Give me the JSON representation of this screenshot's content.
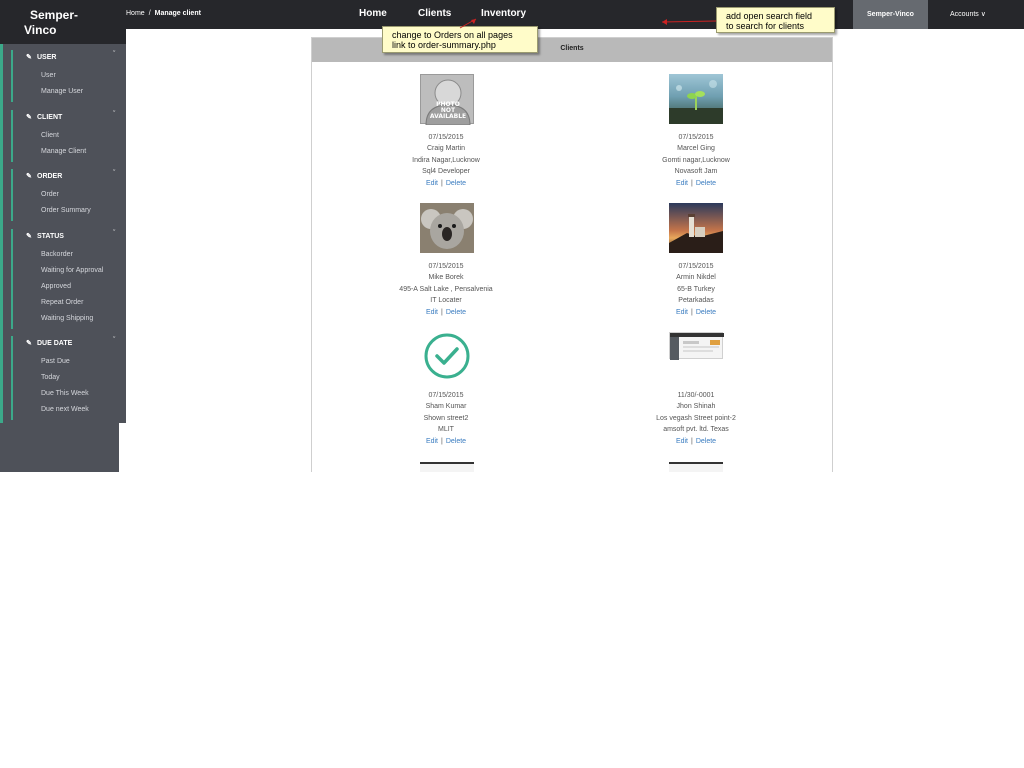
{
  "header": {
    "brand_line1": "Semper-",
    "brand_line2": "Vinco",
    "breadcrumb": {
      "home": "Home",
      "separator": "/",
      "current": "Manage client"
    },
    "nav": [
      {
        "label": "Home"
      },
      {
        "label": "Clients"
      },
      {
        "label": "Inventory"
      }
    ],
    "user_label": "Semper-Vinco",
    "accounts_label": "Accounts ∨"
  },
  "sidebar": {
    "sections": [
      {
        "title": "USER",
        "items": [
          "User",
          "Manage User"
        ]
      },
      {
        "title": "CLIENT",
        "items": [
          "Client",
          "Manage Client"
        ]
      },
      {
        "title": "ORDER",
        "items": [
          "Order",
          "Order Summary"
        ]
      },
      {
        "title": "STATUS",
        "items": [
          "Backorder",
          "Waiting for Approval",
          "Approved",
          "Repeat Order",
          "Waiting Shipping"
        ]
      },
      {
        "title": "DUE DATE",
        "items": [
          "Past Due",
          "Today",
          "Due This Week",
          "Due next Week"
        ]
      }
    ],
    "chevron": "ˇ"
  },
  "panel": {
    "title": "Clients",
    "clients": [
      {
        "date": "07/15/2015",
        "name": "Craig Martin",
        "address": "Indira Nagar,Lucknow",
        "company": "Sql4 Developer",
        "photo": "photo-placeholder",
        "placeholder_text": [
          "PHOTO",
          "NOT",
          "AVAILABLE"
        ]
      },
      {
        "date": "07/15/2015",
        "name": "Marcel Ging",
        "address": "Gomti nagar,Lucknow",
        "company": "Novasoft Jam",
        "photo": "nature-photo"
      },
      {
        "date": "07/15/2015",
        "name": "Mike Borek",
        "address": "495-A Salt Lake , Pensalvenia",
        "company": "IT Locater",
        "photo": "koala-photo"
      },
      {
        "date": "07/15/2015",
        "name": "Armin Nikdel",
        "address": "65-B Turkey",
        "company": "Petarkadas",
        "photo": "lighthouse-photo"
      },
      {
        "date": "07/15/2015",
        "name": "Sham Kumar",
        "address": "Shown street2",
        "company": "MLIT",
        "photo": "check-icon"
      },
      {
        "date": "11/30/-0001",
        "name": "Jhon Shinah",
        "address": "Los vegash Street point-2",
        "company": "amsoft pvt. ltd. Texas",
        "photo": "screenshot-thumb"
      }
    ],
    "edit_label": "Edit",
    "delete_label": "Delete",
    "action_separator": "|"
  },
  "annotations": {
    "orders_note": {
      "line1": "change to Orders on all pages",
      "line2": "link to order-summary.php"
    },
    "search_note": {
      "line1": "add open search field",
      "line2": "to search for clients"
    }
  },
  "colors": {
    "topbar": "#26272b",
    "sidebar": "#4e5159",
    "accent": "#3ca98a",
    "panel_header": "#b9b9b9",
    "link": "#3a7cc0",
    "callout_bg": "#fffcc9"
  }
}
